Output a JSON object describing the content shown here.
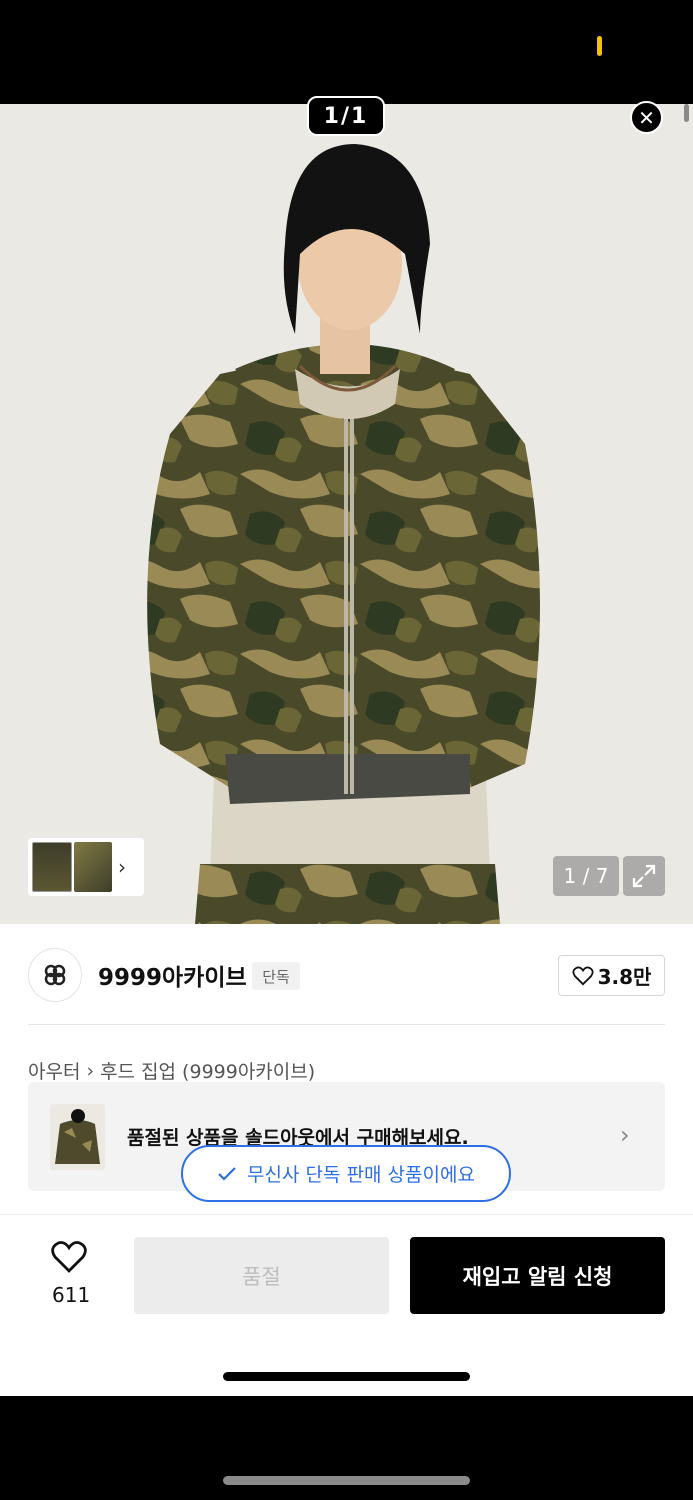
{
  "viewer": {
    "counter": "1/1",
    "image_counter": "1 / 7"
  },
  "brand": {
    "name": "9999아카이브",
    "tag": "단독",
    "likes": "3.8만"
  },
  "breadcrumb": {
    "category": "아우터",
    "subcategory": "후드 집업 (9999아카이브)"
  },
  "banner": {
    "text": "품절된 상품을 솔드아웃에서 구매해보세요."
  },
  "exclusive_pill": {
    "text": "무신사 단독 판매 상품이에요"
  },
  "bottom_bar": {
    "wish_count": "611",
    "soldout_label": "품절",
    "restock_label": "재입고 알림 신청"
  },
  "colors": {
    "accent_blue": "#2d6fe6",
    "camo_dark": "#3b3a22",
    "camo_olive": "#5d5a2e",
    "camo_tan": "#9a8a55"
  },
  "icons": [
    "close-icon",
    "chevron-right-icon",
    "expand-icon",
    "heart-icon",
    "check-icon",
    "brand-logo-icon"
  ]
}
